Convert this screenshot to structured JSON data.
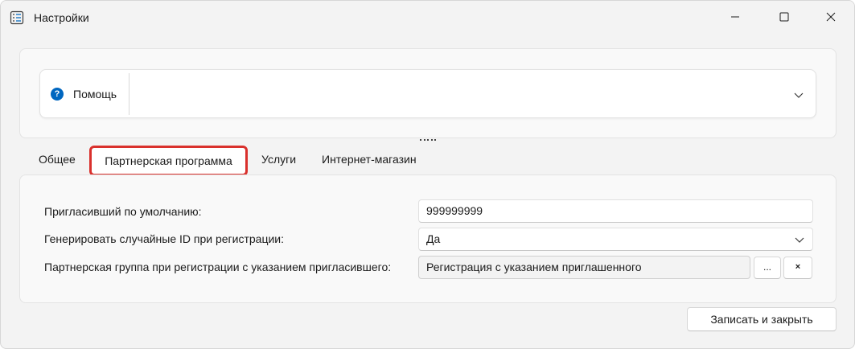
{
  "window": {
    "title": "Настройки",
    "app_icon": "settings-list-icon",
    "controls": {
      "minimize": "minimize-icon",
      "maximize": "maximize-icon",
      "close": "close-icon"
    }
  },
  "help": {
    "icon": "help-icon",
    "icon_glyph": "?",
    "label": "Помощь",
    "expand_icon": "chevron-down-icon"
  },
  "tabs": [
    {
      "label": "Общее",
      "active": false
    },
    {
      "label": "Партнерская программа",
      "active": true
    },
    {
      "label": "Услуги",
      "active": false
    },
    {
      "label": "Интернет-магазин",
      "active": false
    }
  ],
  "form": {
    "inviter_default": {
      "label": "Пригласивший по умолчанию:",
      "value": "999999999"
    },
    "random_id": {
      "label": "Генерировать случайные ID при регистрации:",
      "value": "Да"
    },
    "partner_group": {
      "label": "Партнерская группа при регистрации с указанием пригласившего:",
      "value": "Регистрация с указанием приглашенного",
      "select_button": "...",
      "clear_button": "×"
    }
  },
  "footer": {
    "save_close": "Записать и закрыть"
  },
  "colors": {
    "accent": "#0067c0",
    "highlight": "#d9302c",
    "background": "#f3f3f3"
  }
}
